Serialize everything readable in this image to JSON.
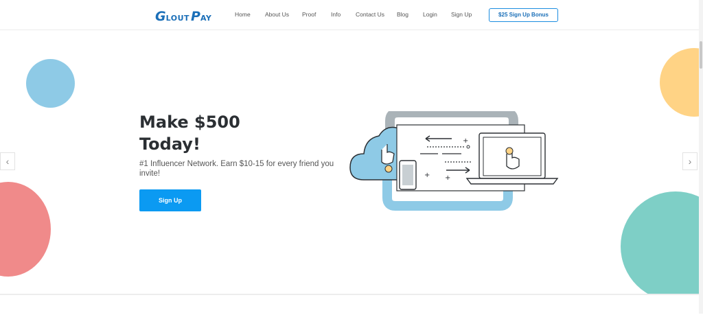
{
  "logo": {
    "big": "G",
    "word1": "LOUT",
    "big2": "P",
    "word2": "AY"
  },
  "nav": {
    "items": [
      "Home",
      "About Us",
      "Proof",
      "Info",
      "Contact Us",
      "Blog",
      "Login",
      "Sign Up"
    ],
    "bonus_button": "$25 Sign Up Bonus"
  },
  "hero": {
    "headline_line1": "Make $500",
    "headline_line2": "Today!",
    "subtext": "#1 Influencer Network. Earn $10-15 for every friend you invite!",
    "cta": "Sign Up",
    "prev_arrow": "‹",
    "next_arrow": "›"
  },
  "colors": {
    "accent": "#0b9af2",
    "circle_blue": "#8ecae6",
    "circle_red": "#f08a8a",
    "circle_yellow": "#ffd385",
    "circle_teal": "#7ecfc6"
  }
}
